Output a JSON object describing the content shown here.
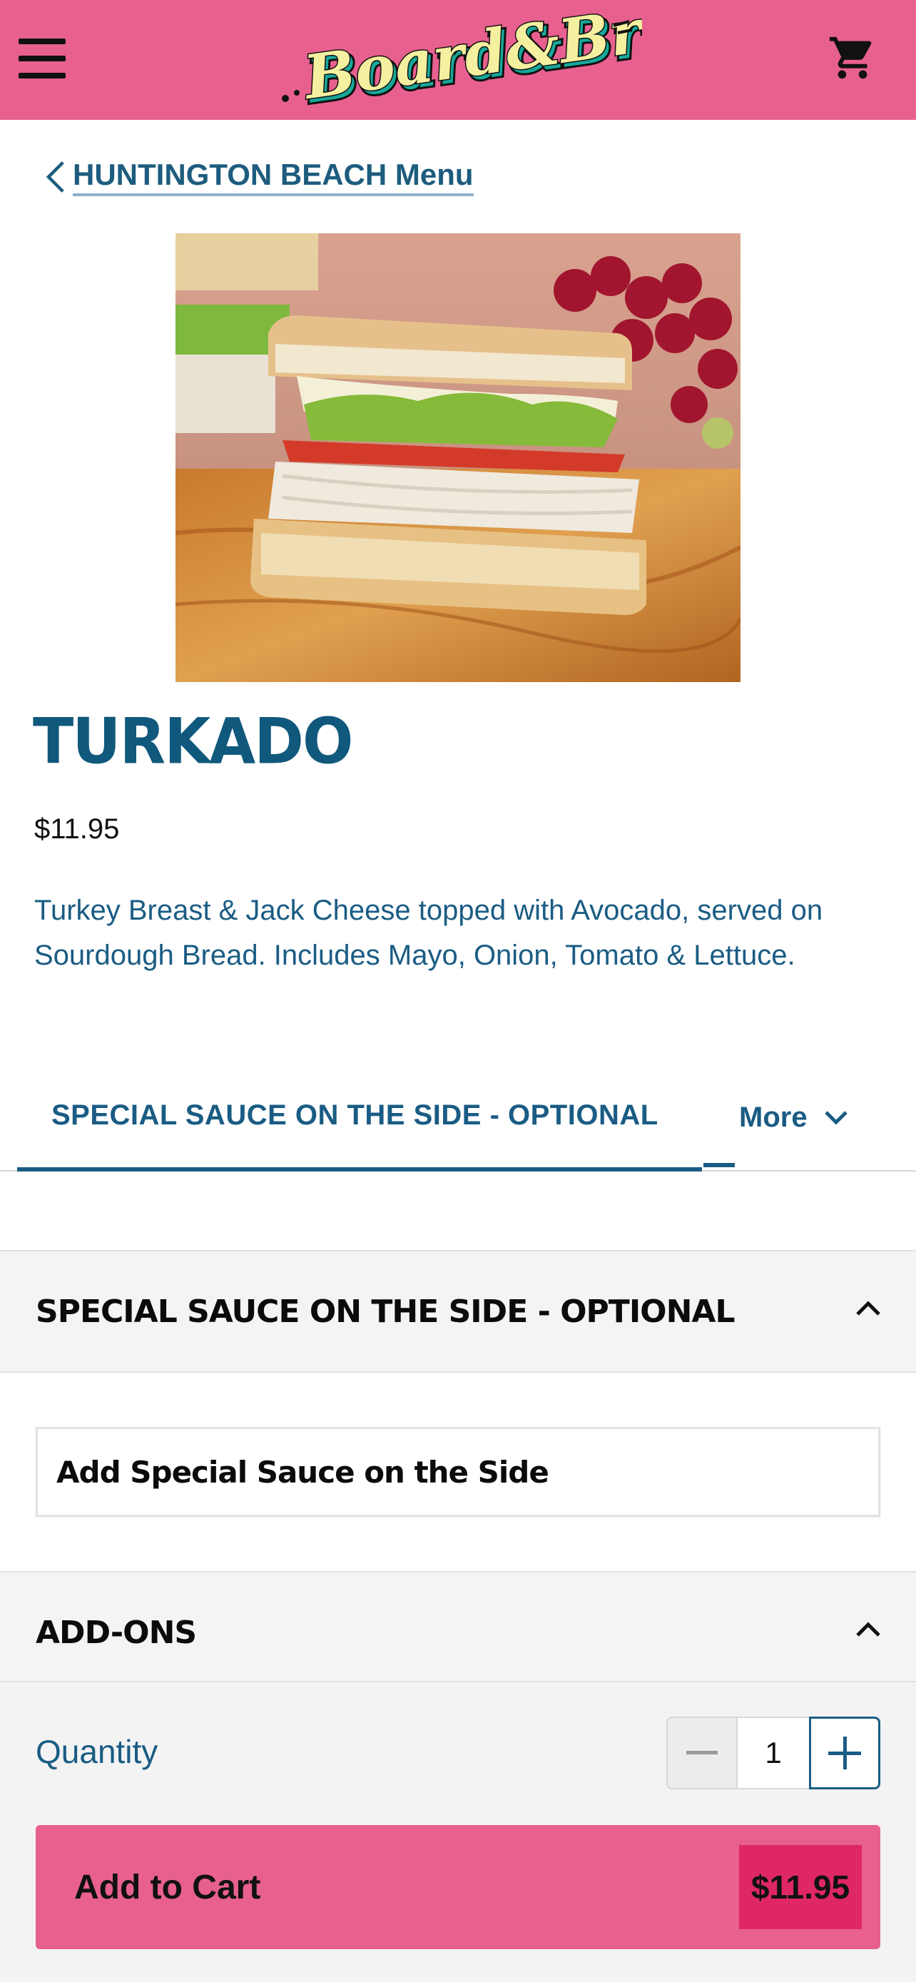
{
  "header": {
    "brand": "Board & Brew",
    "menu_icon": "hamburger-menu-icon",
    "cart_icon": "shopping-cart-icon",
    "bg_color": "#e8608f"
  },
  "breadcrumb": {
    "back_label": "HUNTINGTON BEACH Menu"
  },
  "product": {
    "name": "TURKADO",
    "price": "$11.95",
    "description": "Turkey Breast & Jack Cheese topped with Avocado, served on Sourdough Bread. Includes Mayo, Onion, Tomato & Lettuce."
  },
  "tabs": {
    "active_label": "SPECIAL SAUCE ON THE SIDE - OPTIONAL",
    "more_label": "More"
  },
  "sections": {
    "sauce_title": "SPECIAL SAUCE ON THE SIDE - OPTIONAL",
    "sauce_option": "Add Special Sauce on the Side",
    "addons_title": "ADD-ONS"
  },
  "footer": {
    "quantity_label": "Quantity",
    "quantity_value": "1",
    "add_to_cart_label": "Add to Cart",
    "add_to_cart_price": "$11.95"
  },
  "colors": {
    "brand_pink": "#e8608f",
    "price_badge": "#df2766",
    "accent_blue": "#1a5c84"
  }
}
